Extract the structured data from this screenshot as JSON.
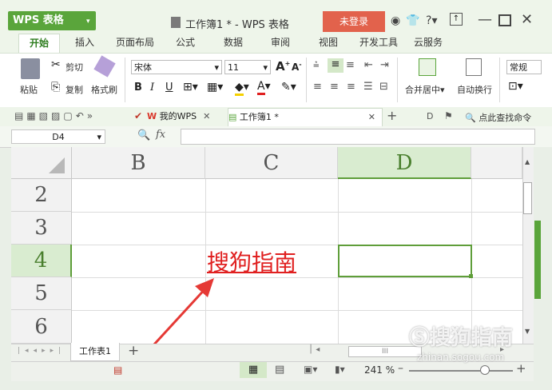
{
  "window": {
    "app_logo": "WPS 表格",
    "title": "工作簿1 * - WPS 表格",
    "login_button": "未登录",
    "help": "?"
  },
  "menu": {
    "tabs": [
      "开始",
      "插入",
      "页面布局",
      "公式",
      "数据",
      "审阅",
      "视图",
      "开发工具",
      "云服务"
    ]
  },
  "ribbon": {
    "paste": "粘贴",
    "cut": "剪切",
    "copy": "复制",
    "format_painter": "格式刷",
    "font_name": "宋体",
    "font_size": "11",
    "bold": "B",
    "italic": "I",
    "underline": "U",
    "merge_center": "合并居中",
    "wrap_text": "自动换行",
    "number_format": "常规"
  },
  "doc_tabs": {
    "mywps": "我的WPS",
    "workbook": "工作簿1 *",
    "search_command": "点此查找命令"
  },
  "formula_bar": {
    "name_box": "D4",
    "fx": "fx",
    "content": ""
  },
  "grid": {
    "columns": [
      "B",
      "C",
      "D"
    ],
    "rows": [
      "2",
      "3",
      "4",
      "5",
      "6"
    ],
    "selected_cell": "D4",
    "cell_c4": "搜狗指南"
  },
  "sheets": {
    "tabs": [
      "工作表1"
    ],
    "add": "+"
  },
  "status": {
    "zoom": "241 %"
  },
  "watermark": {
    "brand": "搜狗指南",
    "url": "zhinan.sogou.com"
  },
  "colors": {
    "accent_green": "#5aa53b",
    "login_red": "#e2624c",
    "text_red": "#e02020",
    "arrow_red": "#e53935"
  }
}
